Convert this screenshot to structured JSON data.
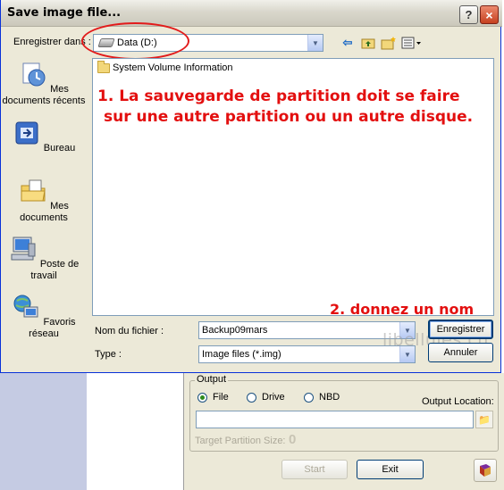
{
  "dialog": {
    "title": "Save image file...",
    "help_icon": "?",
    "close_icon": "×",
    "save_in_label": "Enregistrer dans :",
    "save_in_value": "Data (D:)",
    "toolbar_icons": [
      "back-arrow-icon",
      "up-folder-icon",
      "new-folder-icon",
      "view-menu-icon"
    ],
    "places": [
      {
        "label": "Mes documents récents",
        "icon": "recent-documents-icon"
      },
      {
        "label": "Bureau",
        "icon": "desktop-icon"
      },
      {
        "label": "Mes documents",
        "icon": "my-documents-icon"
      },
      {
        "label": "Poste de travail",
        "icon": "my-computer-icon"
      },
      {
        "label": "Favoris réseau",
        "icon": "network-places-icon"
      }
    ],
    "files": [
      {
        "name": "System Volume Information",
        "icon": "folder-icon"
      }
    ],
    "filename_label": "Nom du fichier :",
    "filename_value": "Backup09mars",
    "type_label": "Type :",
    "type_value": "Image files (*.img)",
    "save_button": "Enregistrer",
    "cancel_button": "Annuler"
  },
  "annotations": {
    "note1_line1": "1. La sauvegarde de partition doit se faire",
    "note1_line2": "sur une autre partition ou un autre disque.",
    "note2": "2. donnez un nom",
    "watermark": "libellules.ch",
    "colors": {
      "annotation": "#e30f0f"
    }
  },
  "background_app": {
    "output_legend": "Output",
    "radio_options": [
      {
        "label": "File",
        "selected": true
      },
      {
        "label": "Drive",
        "selected": false
      },
      {
        "label": "NBD",
        "selected": false
      }
    ],
    "output_location_label": "Output Location:",
    "output_location_value": "",
    "target_partition_label": "Target Partition Size:",
    "target_partition_value": "0",
    "start_button": "Start",
    "exit_button": "Exit",
    "help_book_icon": "book-icon"
  }
}
